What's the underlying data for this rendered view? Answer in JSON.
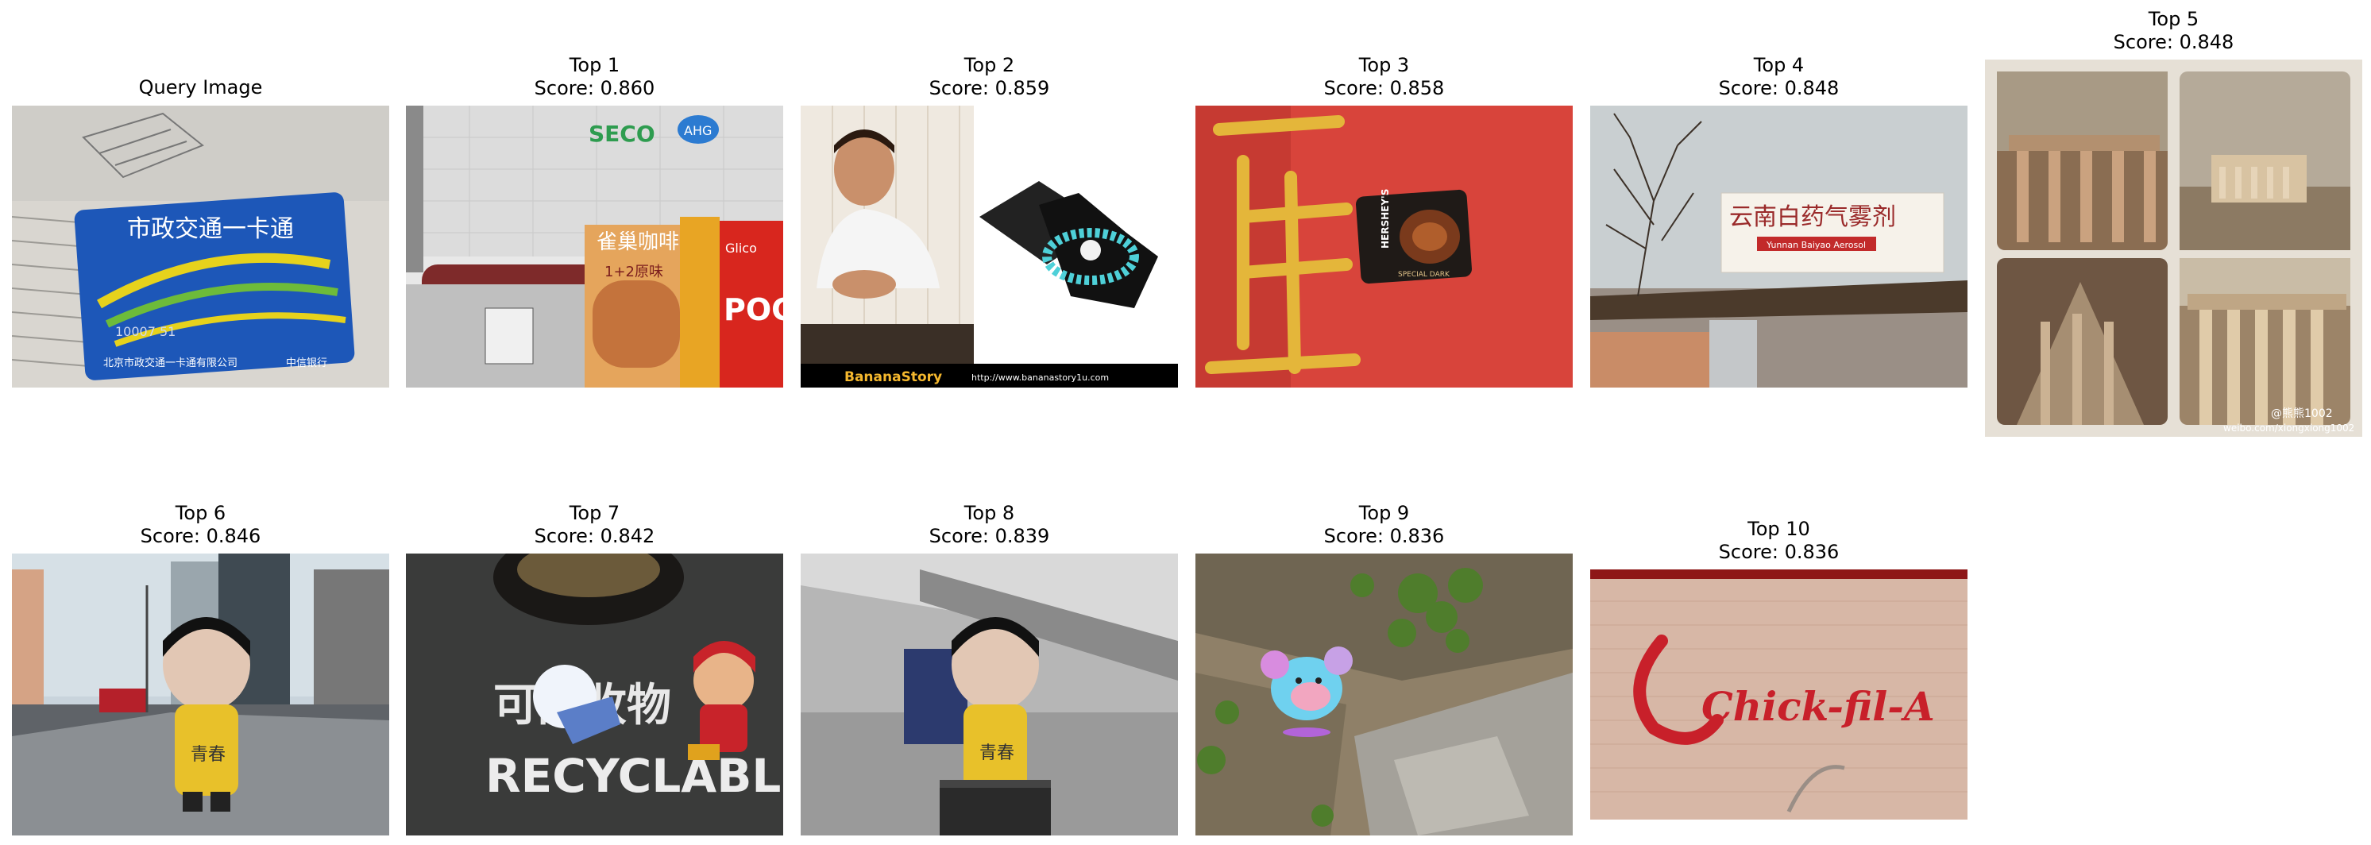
{
  "query": {
    "title": "Query Image",
    "card_text": {
      "brand": "市政交通一卡通",
      "number": "10007 51",
      "issuer": "北京市政交通一卡通有限公司",
      "bank": "中信银行"
    }
  },
  "results": [
    {
      "rank_label": "Top 1",
      "score_label": "Score: 0.860",
      "sign_text_1": "SECO",
      "sign_text_2": "AHG",
      "box_text": "雀巢咖啡",
      "box_sub": "1+2原味",
      "pocky_text": "POC",
      "pocky_brand": "Glico"
    },
    {
      "rank_label": "Top 2",
      "score_label": "Score: 0.859",
      "banner_brand": "BananaStory",
      "banner_url": "http://www.bananastory1u.com"
    },
    {
      "rank_label": "Top 3",
      "score_label": "Score: 0.858",
      "tin_brand": "HERSHEY'S",
      "tin_sub": "SPECIAL DARK"
    },
    {
      "rank_label": "Top 4",
      "score_label": "Score: 0.848",
      "sign_cn": "云南白药气雾剂",
      "sign_en": "Yunnan Baiyao Aerosol"
    },
    {
      "rank_label": "Top 5",
      "score_label": "Score: 0.848",
      "watermark_1": "@熊熊1002",
      "watermark_2": "weibo.com/xiongxiong1002"
    },
    {
      "rank_label": "Top 6",
      "score_label": "Score: 0.846",
      "figure_text": "青春"
    },
    {
      "rank_label": "Top 7",
      "score_label": "Score: 0.842",
      "bin_cn": "可回收物",
      "bin_en": "RECYCLABL"
    },
    {
      "rank_label": "Top 8",
      "score_label": "Score: 0.839",
      "figure_text": "青春"
    },
    {
      "rank_label": "Top 9",
      "score_label": "Score: 0.836"
    },
    {
      "rank_label": "Top 10",
      "score_label": "Score: 0.836",
      "logo_text": "Chick-fil-A"
    }
  ]
}
